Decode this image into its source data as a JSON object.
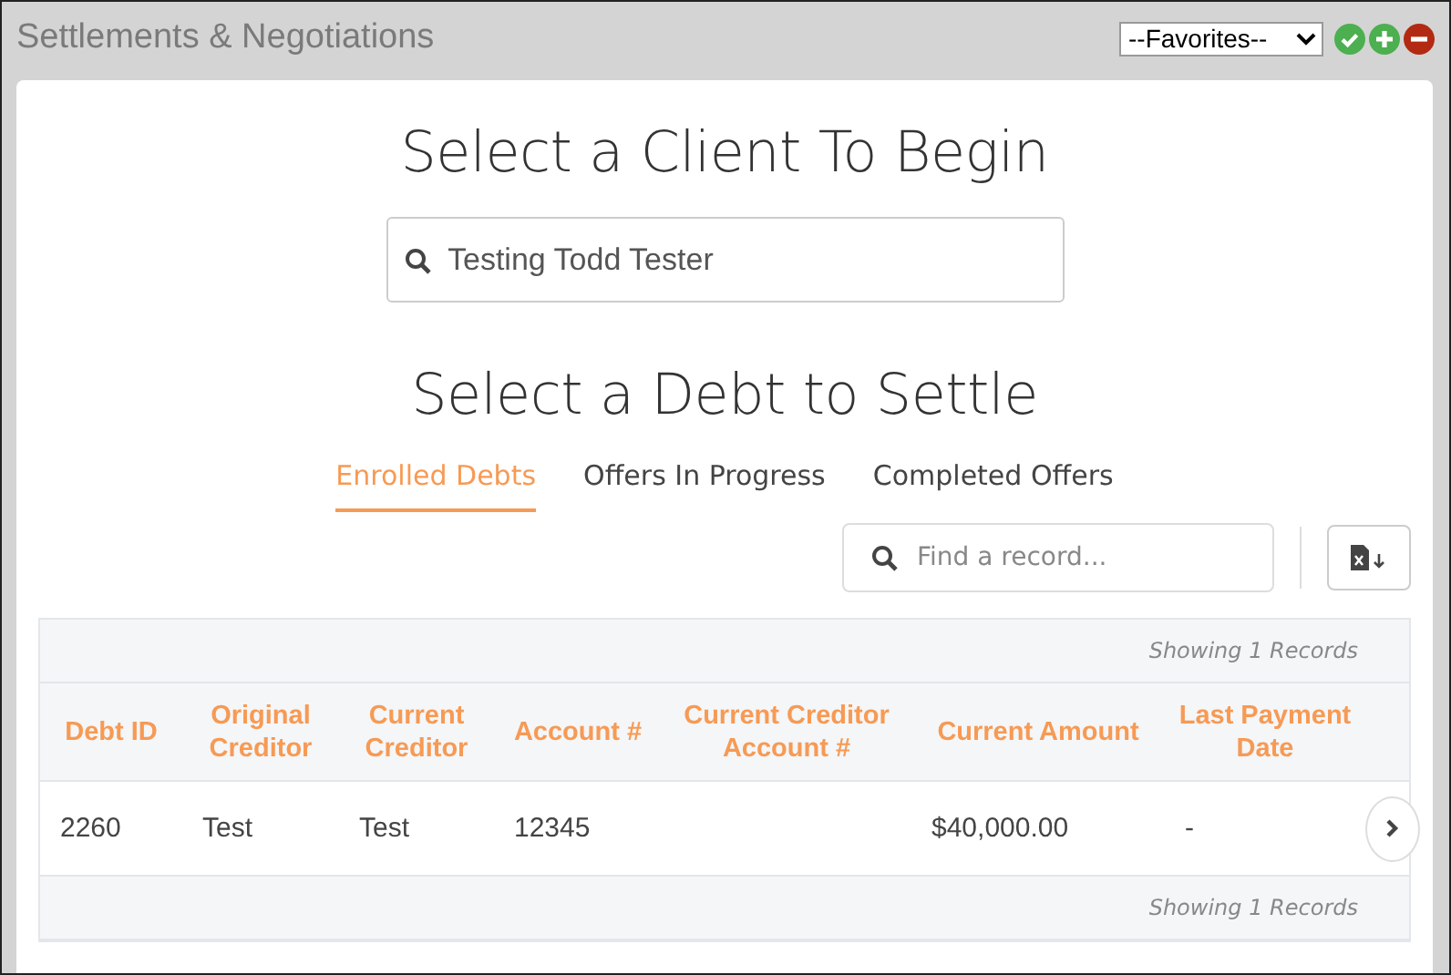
{
  "window": {
    "title": "Settlements & Negotiations"
  },
  "favorites": {
    "value": "--Favorites--"
  },
  "heading": "Select a Client To Begin",
  "client_search": {
    "value": "Testing Todd Tester"
  },
  "subheading": "Select a Debt to Settle",
  "tabs": [
    {
      "label": "Enrolled Debts",
      "selected": true
    },
    {
      "label": "Offers In Progress",
      "selected": false
    },
    {
      "label": "Completed Offers",
      "selected": false
    }
  ],
  "record_search": {
    "placeholder": "Find a record..."
  },
  "table": {
    "summary_top": "Showing 1 Records",
    "summary_bottom": "Showing 1 Records",
    "columns": [
      "Debt ID",
      "Original Creditor",
      "Current Creditor",
      "Account #",
      "Current Creditor Account #",
      "Current Amount",
      "Last Payment Date"
    ],
    "rows": [
      {
        "cells": [
          "2260",
          "Test",
          "Test",
          "12345",
          "",
          "$40,000.00",
          "-"
        ]
      }
    ]
  }
}
